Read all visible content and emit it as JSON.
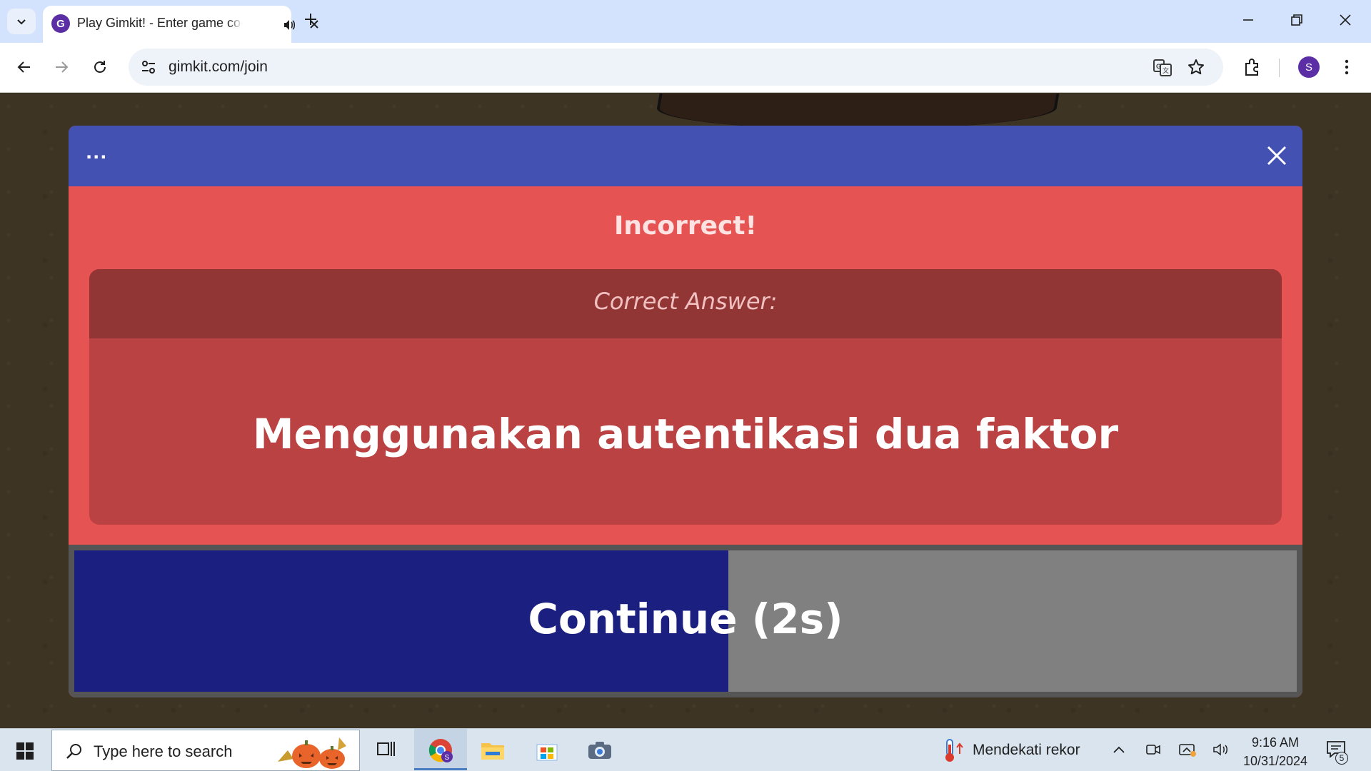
{
  "browser": {
    "tab": {
      "favicon_letter": "G",
      "title": "Play Gimkit! - Enter game code",
      "audio_icon": "speaker-icon",
      "close_icon": "close-icon"
    },
    "new_tab_icon": "plus-icon",
    "url": "gimkit.com/join",
    "profile_initial": "S",
    "accent_color": "#5b2ea6"
  },
  "modal": {
    "menu_label": "...",
    "result_title": "Incorrect!",
    "answer_label": "Correct Answer:",
    "answer_text": "Menggunakan autentikasi dua faktor",
    "continue_label": "Continue (2s)",
    "continue_progress": 0.535,
    "colors": {
      "header": "#4352b2",
      "background": "#e55352",
      "answer_box": "#ba4242",
      "answer_label_bar": "#923535",
      "progress": "#1b2080",
      "button_remaining": "#808080"
    }
  },
  "taskbar": {
    "search_placeholder": "Type here to search",
    "weather_text": "Mendekati rekor",
    "time": "9:16 AM",
    "date": "10/31/2024",
    "notification_count": "5",
    "apps": [
      "task-view-icon",
      "chrome-icon",
      "file-explorer-icon",
      "microsoft-store-icon",
      "camera-icon"
    ]
  }
}
